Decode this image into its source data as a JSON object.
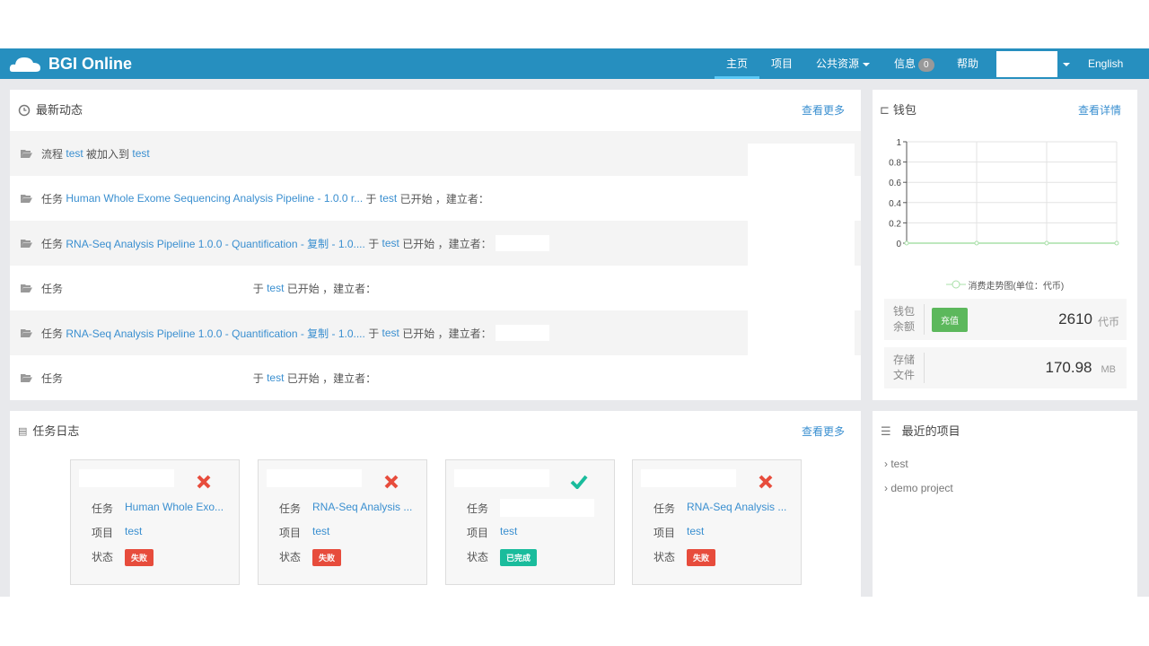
{
  "nav": {
    "brand": "BGI Online",
    "items": [
      {
        "label": "主页",
        "active": true
      },
      {
        "label": "项目"
      },
      {
        "label": "公共资源"
      },
      {
        "label": "信息",
        "badge": "0"
      },
      {
        "label": "帮助"
      }
    ],
    "language": "English"
  },
  "activity": {
    "title": "最新动态",
    "more": "查看更多",
    "rows": [
      {
        "prefix": "流程",
        "link1": "test",
        "mid": "被加入到",
        "link2": "test",
        "suffix": ""
      },
      {
        "prefix": "任务",
        "link1": "Human Whole Exome Sequencing Analysis Pipeline - 1.0.0 r...",
        "mid": "于",
        "link2": "test",
        "suffix": "已开始 ，建立者："
      },
      {
        "prefix": "任务",
        "link1": "RNA-Seq Analysis Pipeline 1.0.0 - Quantification - 复制 - 1.0....",
        "mid": "于",
        "link2": "test",
        "suffix": "已开始 ，建立者："
      },
      {
        "prefix": "任务",
        "link1": "",
        "mid": "于",
        "link2": "test",
        "suffix": "已开始 ，建立者："
      },
      {
        "prefix": "任务",
        "link1": "RNA-Seq Analysis Pipeline 1.0.0 - Quantification - 复制 - 1.0....",
        "mid": "于",
        "link2": "test",
        "suffix": "已开始 ，建立者："
      },
      {
        "prefix": "任务",
        "link1": "",
        "mid": "于",
        "link2": "test",
        "suffix": "已开始 ，建立者："
      }
    ]
  },
  "wallet": {
    "title": "钱包",
    "more": "查看详情",
    "legend": "消费走势图(单位：代币)",
    "balance_label1": "钱包",
    "balance_label2": "余额",
    "recharge": "充值",
    "balance": "2610",
    "balance_unit": "代币",
    "storage_label1": "存储",
    "storage_label2": "文件",
    "storage": "170.98",
    "storage_unit": "MB"
  },
  "chart_data": {
    "type": "line",
    "yticks": [
      "1",
      "0.8",
      "0.6",
      "0.4",
      "0.2",
      "0"
    ],
    "ylim": [
      0,
      1
    ],
    "series": [
      {
        "name": "消费走势图(单位：代币)",
        "values": [
          0,
          0,
          0,
          0
        ]
      }
    ],
    "color": "#a8e0a8"
  },
  "joblog": {
    "title": "任务日志",
    "more": "查看更多",
    "labels": {
      "task": "任务",
      "project": "项目",
      "status": "状态"
    },
    "cards": [
      {
        "icon": "cross",
        "task": "Human Whole Exo...",
        "project": "test",
        "status": "失败",
        "status_color": "#e74c3c"
      },
      {
        "icon": "cross",
        "task": "RNA-Seq Analysis ...",
        "project": "test",
        "status": "失败",
        "status_color": "#e74c3c"
      },
      {
        "icon": "check",
        "task": "",
        "project": "test",
        "status": "已完成",
        "status_color": "#1abc9c"
      },
      {
        "icon": "cross",
        "task": "RNA-Seq Analysis ...",
        "project": "test",
        "status": "失败",
        "status_color": "#e74c3c"
      }
    ]
  },
  "recent": {
    "title": "最近的项目",
    "items": [
      "test",
      "demo project"
    ]
  }
}
